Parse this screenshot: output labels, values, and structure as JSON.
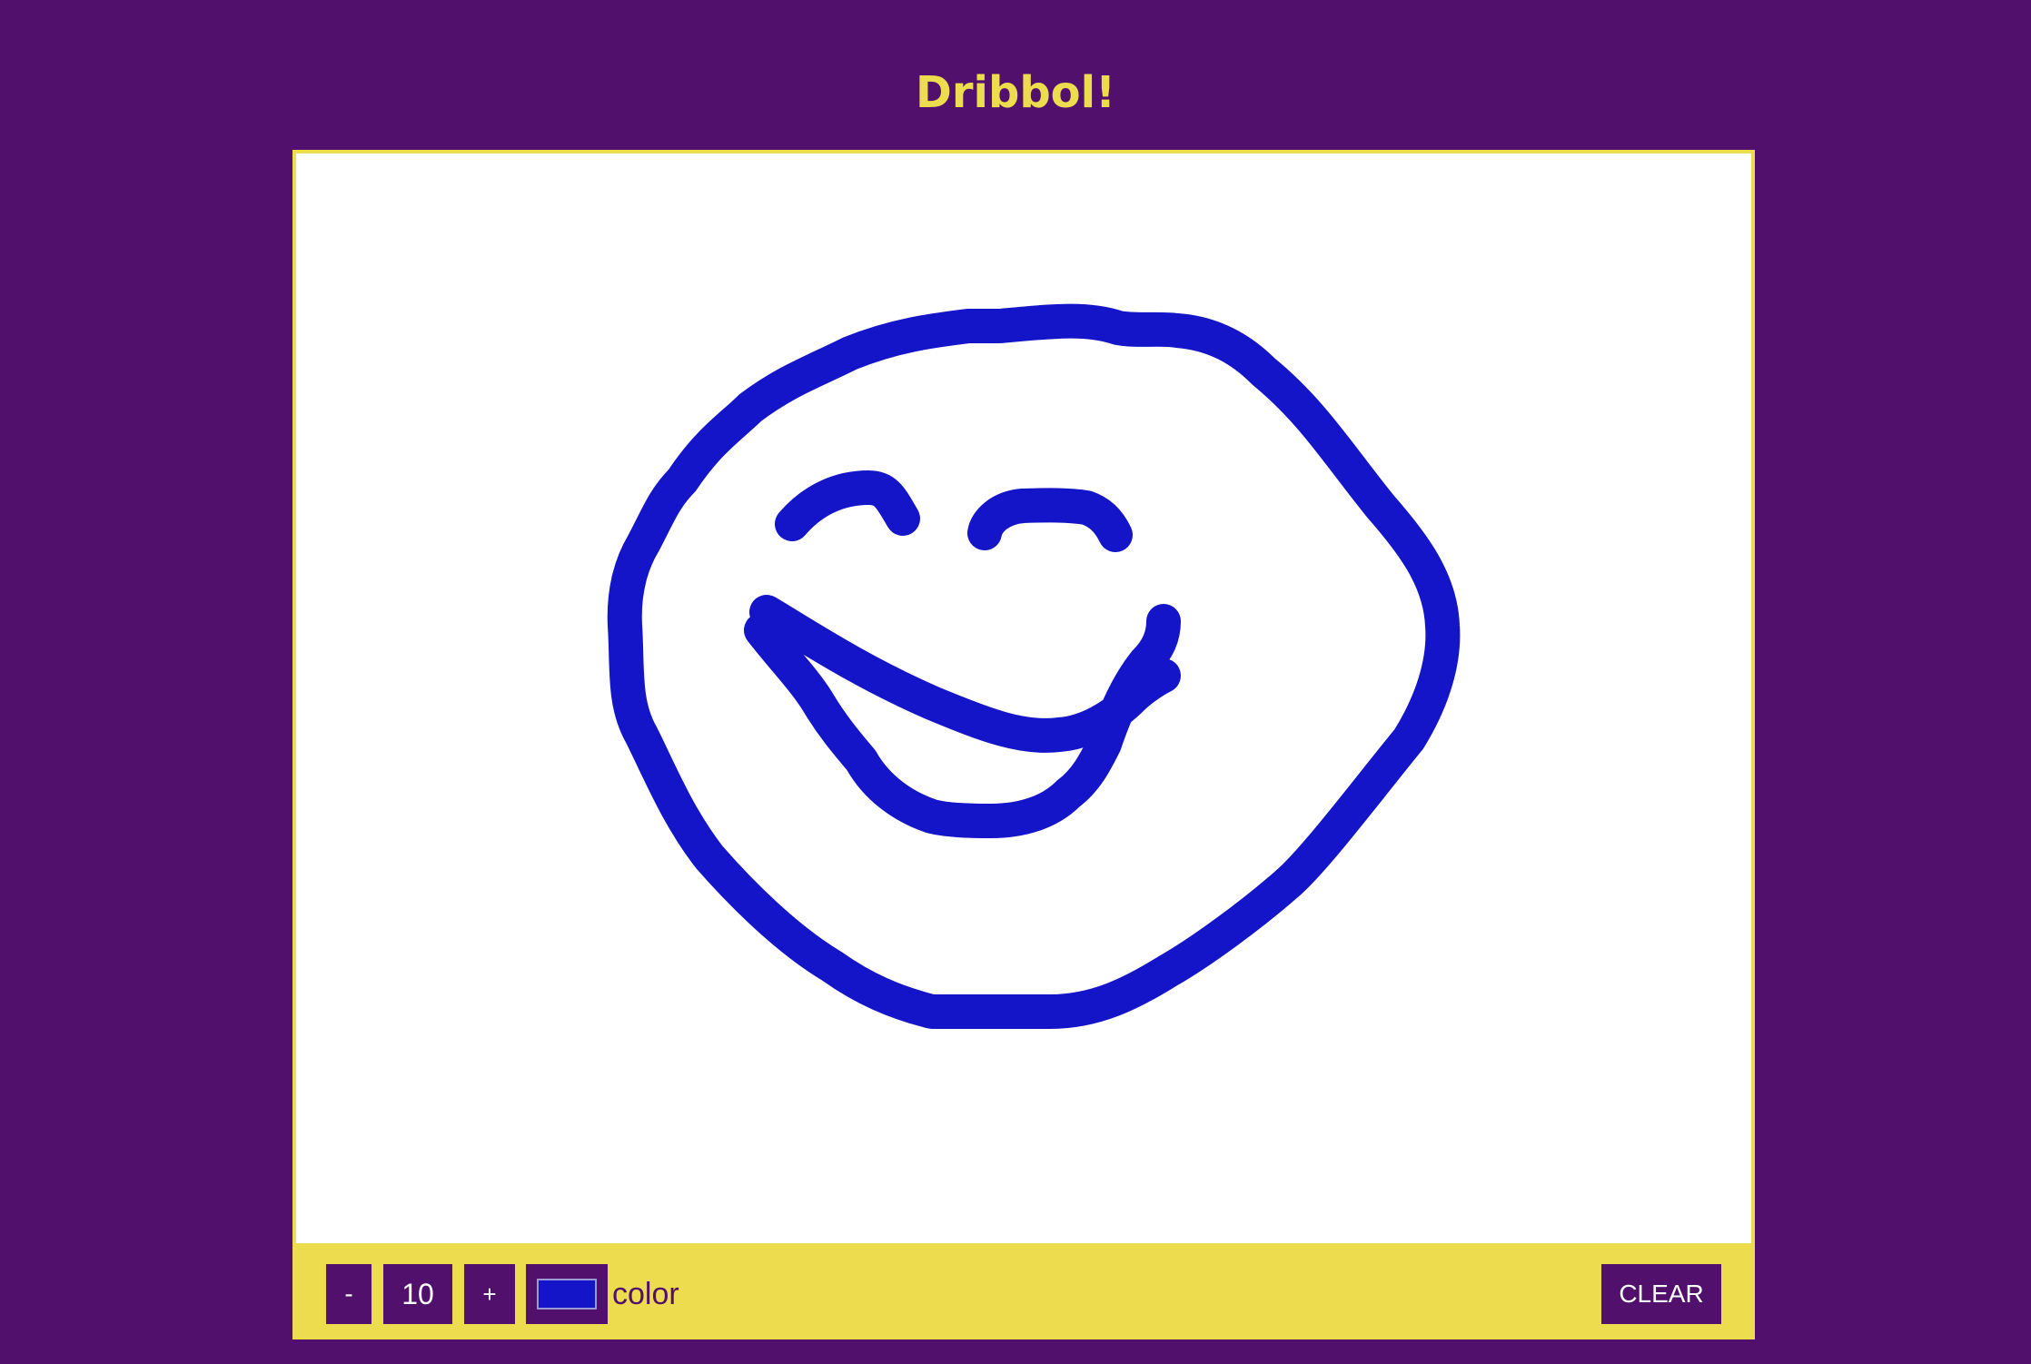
{
  "app": {
    "title": "Dribbol!"
  },
  "toolbar": {
    "decrease_label": "-",
    "brush_size": "10",
    "increase_label": "+",
    "color_label": "color",
    "clear_label": "CLEAR"
  },
  "colors": {
    "background": "#51106b",
    "accent": "#eddc4e",
    "canvas": "#ffffff",
    "current_brush_color": "#1414c8"
  },
  "icons": {
    "color_swatch": "color-swatch-icon"
  }
}
